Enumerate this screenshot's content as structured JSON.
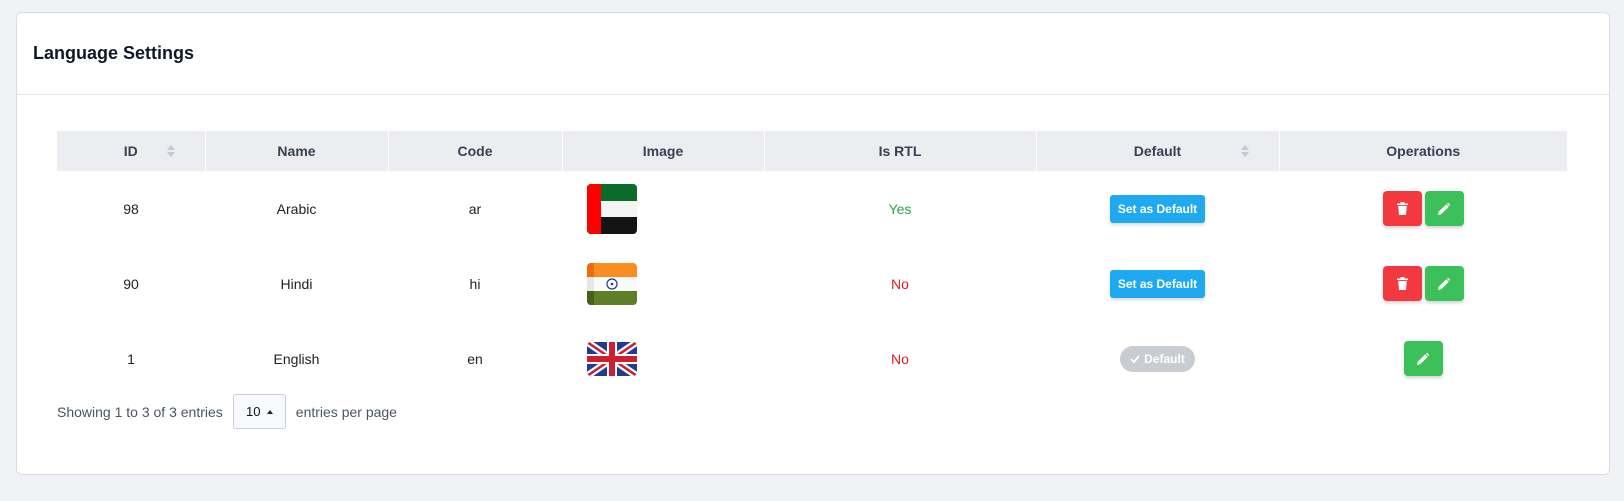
{
  "card": {
    "title": "Language Settings"
  },
  "table": {
    "columns": [
      "ID",
      "Name",
      "Code",
      "Image",
      "Is RTL",
      "Default",
      "Operations"
    ],
    "rows": [
      {
        "id": "98",
        "name": "Arabic",
        "code": "ar",
        "flag": "uae-flag",
        "is_rtl": "Yes",
        "default_label": "Set as Default",
        "can_delete": true
      },
      {
        "id": "90",
        "name": "Hindi",
        "code": "hi",
        "flag": "india-flag",
        "is_rtl": "No",
        "default_label": "Set as Default",
        "can_delete": true
      },
      {
        "id": "1",
        "name": "English",
        "code": "en",
        "flag": "uk-flag",
        "is_rtl": "No",
        "default_label": "Default",
        "can_delete": false
      }
    ]
  },
  "footer": {
    "showing": "Showing 1 to 3 of 3 entries",
    "per_page_value": "10",
    "per_page_suffix": "entries per page"
  },
  "colors": {
    "set_default_button": "#1fa9f0",
    "delete_button": "#f3383f",
    "edit_button": "#3cc15a",
    "rtl_yes": "#28a745",
    "rtl_no": "#dc1f26"
  },
  "icons": [
    "sort-icon",
    "trash-icon",
    "pencil-icon",
    "check-icon",
    "caret-up-icon"
  ]
}
